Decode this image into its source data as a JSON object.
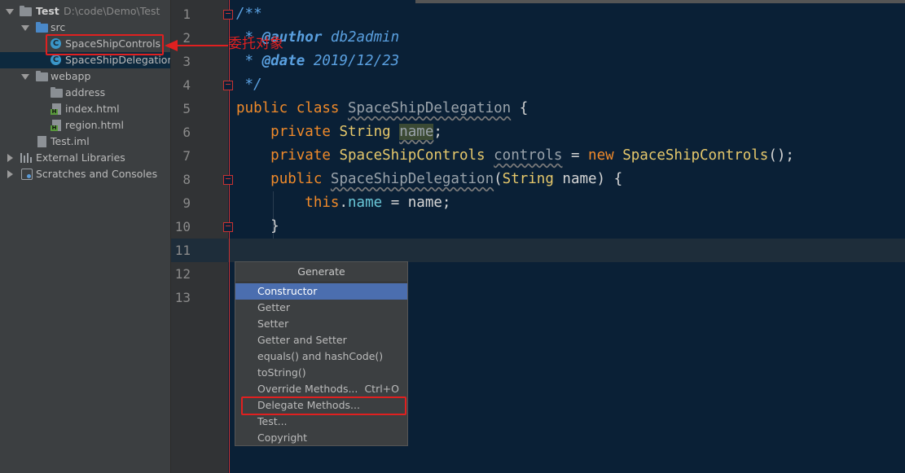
{
  "tree": {
    "project_name": "Test",
    "project_path": "D:\\code\\Demo\\Test",
    "src_label": "src",
    "items": [
      {
        "label": "SpaceShipControls"
      },
      {
        "label": "SpaceShipDelegation"
      }
    ],
    "webapp_label": "webapp",
    "web_items": [
      {
        "label": "address"
      },
      {
        "label": "index.html"
      },
      {
        "label": "region.html"
      }
    ],
    "iml_label": "Test.iml",
    "external_label": "External Libraries",
    "scratches_label": "Scratches and Consoles",
    "class_icon_letter": "C",
    "html_icon_letter": "H"
  },
  "annotation": {
    "text": "委托对象",
    "color": "#e02020"
  },
  "editor": {
    "line_numbers": [
      "1",
      "2",
      "3",
      "4",
      "5",
      "6",
      "7",
      "8",
      "9",
      "10",
      "11",
      "12",
      "13"
    ],
    "lines": {
      "l1": "/**",
      "l2_star": " * ",
      "l2_tag": "@author",
      "l2_rest": " db2admin",
      "l3_star": " * ",
      "l3_tag": "@date",
      "l3_rest": " 2019/12/23",
      "l4": " */",
      "l5_kw1": "public",
      "l5_kw2": "class",
      "l5_name": "SpaceShipDelegation",
      "l5_brace": " {",
      "l6_kw": "private",
      "l6_type": "String",
      "l6_field": "name",
      "l6_end": ";",
      "l7_kw": "private",
      "l7_type": "SpaceShipControls",
      "l7_field": "controls",
      "l7_eq": " = ",
      "l7_new": "new",
      "l7_ctor": "SpaceShipControls",
      "l7_end": "();",
      "l8_kw": "public",
      "l8_name": "SpaceShipDelegation",
      "l8_p1": "(",
      "l8_type": "String",
      "l8_p2": " name) {",
      "l9_this": "this",
      "l9_dot": ".",
      "l9_field": "name",
      "l9_rest": " = name;",
      "l10": "}"
    }
  },
  "generate_menu": {
    "title": "Generate",
    "items": [
      {
        "label": "Constructor",
        "shortcut": ""
      },
      {
        "label": "Getter",
        "shortcut": ""
      },
      {
        "label": "Setter",
        "shortcut": ""
      },
      {
        "label": "Getter and Setter",
        "shortcut": ""
      },
      {
        "label": "equals() and hashCode()",
        "shortcut": ""
      },
      {
        "label": "toString()",
        "shortcut": ""
      },
      {
        "label": "Override Methods...",
        "shortcut": "Ctrl+O"
      },
      {
        "label": "Delegate Methods...",
        "shortcut": ""
      },
      {
        "label": "Test...",
        "shortcut": ""
      },
      {
        "label": "Copyright",
        "shortcut": ""
      }
    ],
    "selected_index": 0
  },
  "colors": {
    "editor_bg": "#0a2036",
    "keyword": "#f08a2a",
    "type": "#e6c86b",
    "doc_comment": "#5aa0e0",
    "selection": "#4b6eaf",
    "highlight_box": "#e02020"
  }
}
